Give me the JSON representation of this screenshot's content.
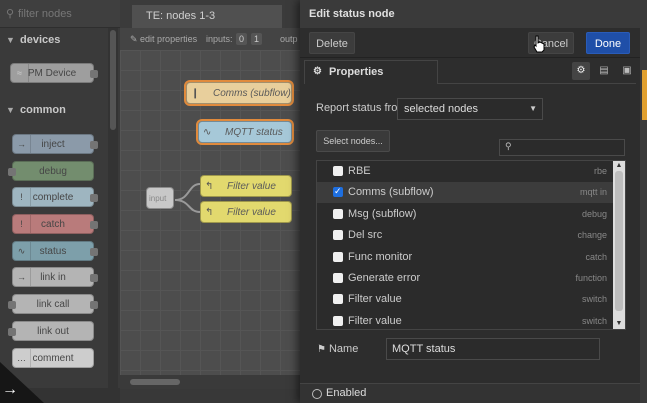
{
  "palette": {
    "search_placeholder": "filter nodes",
    "categories": [
      {
        "name": "devices"
      },
      {
        "name": "common"
      }
    ],
    "nodes": [
      {
        "label": "PM Device",
        "color": "#c0c0c0"
      },
      {
        "label": "inject",
        "color": "#a6bbcf"
      },
      {
        "label": "debug",
        "color": "#87a980"
      },
      {
        "label": "complete",
        "color": "#c0deed"
      },
      {
        "label": "catch",
        "color": "#e49191"
      },
      {
        "label": "status",
        "color": "#94c1d0"
      },
      {
        "label": "link in",
        "color": "#dddddd"
      },
      {
        "label": "link call",
        "color": "#dddddd"
      },
      {
        "label": "link out",
        "color": "#dddddd"
      },
      {
        "label": "comment",
        "color": "#ffffff"
      }
    ],
    "corner_arrow": "→"
  },
  "workspace": {
    "tab_label": "TE: nodes 1-3",
    "edit_properties": "edit properties",
    "inputs_label": "inputs:",
    "inputs_values": [
      "0",
      "1"
    ],
    "outputs_label": "outp",
    "nodes": [
      {
        "label": "Comms (subflow)",
        "color": "#e8cf9c",
        "selected": true
      },
      {
        "label": "MQTT status",
        "color": "#a6c8d8",
        "selected": true
      },
      {
        "label": "input",
        "color": "#c8c8c8",
        "selected": false
      },
      {
        "label": "Filter value",
        "color": "#e2d96e",
        "selected": false
      },
      {
        "label": "Filter value",
        "color": "#e2d96e",
        "selected": false
      }
    ]
  },
  "tray": {
    "title": "Edit status node",
    "delete_label": "Delete",
    "cancel_label": "Cancel",
    "done_label": "Done",
    "properties_tab": "Properties",
    "report_label": "Report status from",
    "report_value": "selected nodes",
    "select_nodes_label": "Select nodes...",
    "node_list": [
      {
        "label": "RBE",
        "type": "rbe",
        "checked": false
      },
      {
        "label": "Comms (subflow)",
        "type": "mqtt in",
        "checked": true
      },
      {
        "label": "Msg (subflow)",
        "type": "debug",
        "checked": false
      },
      {
        "label": "Del src",
        "type": "change",
        "checked": false
      },
      {
        "label": "Func monitor",
        "type": "catch",
        "checked": false
      },
      {
        "label": "Generate error",
        "type": "function",
        "checked": false
      },
      {
        "label": "Filter value",
        "type": "switch",
        "checked": false
      },
      {
        "label": "Filter value",
        "type": "switch",
        "checked": false
      }
    ],
    "name_label": "Name",
    "name_value": "MQTT status",
    "enabled_label": "Enabled"
  },
  "colors": {
    "accent_done": "#1f4fa8",
    "selection_outline": "#e08a3c",
    "checkbox_on": "#1e6fe0"
  }
}
